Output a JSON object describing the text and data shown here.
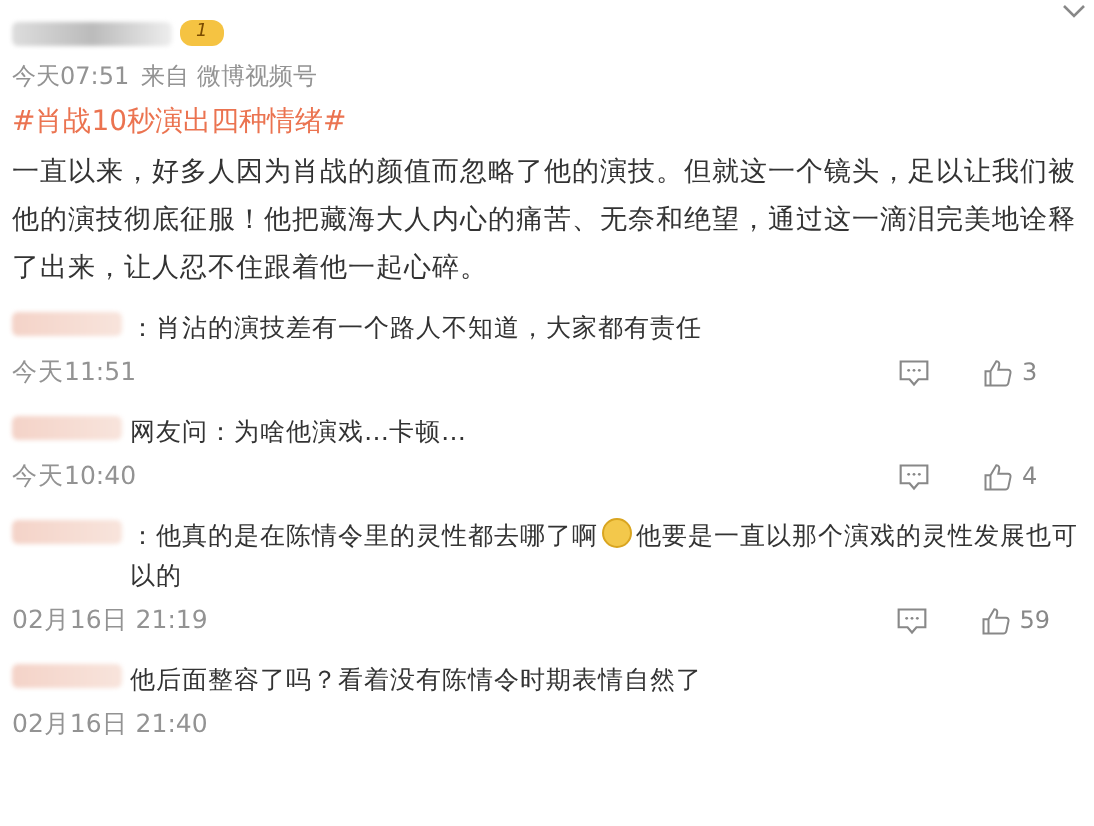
{
  "post": {
    "level_badge": "1",
    "meta": {
      "time": "今天07:51",
      "source": "来自 微博视频号"
    },
    "hashtag": "#肖战10秒演出四种情绪#",
    "body": "一直以来，好多人因为肖战的颜值而忽略了他的演技。但就这一个镜头，足以让我们被他的演技彻底征服！他把藏海大人内心的痛苦、无奈和绝望，通过这一滴泪完美地诠释了出来，让人忍不住跟着他一起心碎。"
  },
  "comments": [
    {
      "text": "：肖沾的演技差有一个路人不知道，大家都有责任",
      "time": "今天11:51",
      "likes": "3"
    },
    {
      "text": "网友问：为啥他演戏…卡顿…",
      "time": "今天10:40",
      "likes": "4"
    },
    {
      "text": "：他真的是在陈情令里的灵性都去哪了啊",
      "text_after_emoji": "他要是一直以那个演戏的灵性发展也可以的",
      "time": "02月16日 21:19",
      "likes": "59"
    },
    {
      "text": "他后面整容了吗？看着没有陈情令时期表情自然了",
      "time": "02月16日 21:40"
    }
  ]
}
